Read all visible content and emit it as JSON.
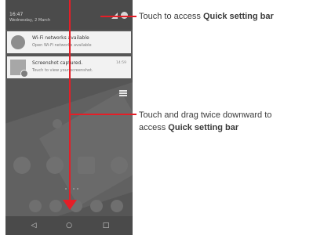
{
  "status_bar": {
    "time": "16:47",
    "date": "Wednesday, 2 March"
  },
  "notifications": [
    {
      "title": "Wi-Fi networks available",
      "subtitle": "Open Wi-Fi networks available",
      "time": ""
    },
    {
      "title": "Screenshot captured.",
      "subtitle": "Touch to view your screenshot.",
      "time": "14:59"
    }
  ],
  "nav": {
    "back": "◁",
    "home": "○",
    "recents": "□"
  },
  "annotations": {
    "top_prefix": "Touch to access ",
    "top_bold": "Quick setting bar",
    "mid_line1": "Touch and drag twice downward to",
    "mid_prefix": "access ",
    "mid_bold": "Quick setting bar"
  },
  "colors": {
    "arrow": "#e51e27",
    "screen": "#565656"
  }
}
